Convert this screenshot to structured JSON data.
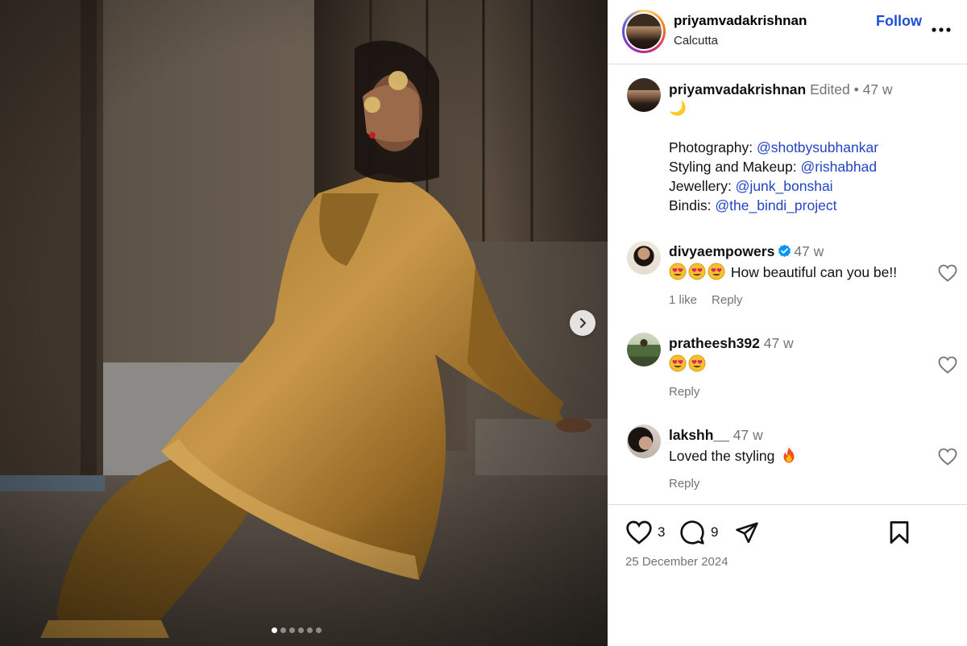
{
  "post": {
    "author": "priyamvadakrishnan",
    "location": "Calcutta",
    "follow_label": "Follow",
    "more_label": "•••",
    "image_alt": "Woman in golden brocade kurta sitting against a weathered wooden door, hand covering one eye",
    "carousel": {
      "total": 6,
      "active_index": 0
    }
  },
  "caption": {
    "username": "priyamvadakrishnan",
    "edited": "Edited",
    "separator": "•",
    "time": "47 w",
    "emoji_line": "🌙",
    "credits": [
      {
        "label": "Photography: ",
        "mention": "@shotbysubhankar"
      },
      {
        "label": "Styling and Makeup: ",
        "mention": "@rishabhad"
      },
      {
        "label": "Jewellery: ",
        "mention": "@junk_bonshai"
      },
      {
        "label": "Bindis: ",
        "mention": "@the_bindi_project"
      }
    ]
  },
  "comments": [
    {
      "username": "divyaempowers",
      "verified": true,
      "time": "47 w",
      "text": "How beautiful can you be!!",
      "emoji_count": 3,
      "likes": "1 like",
      "reply": "Reply"
    },
    {
      "username": "pratheesh392",
      "verified": false,
      "time": "47 w",
      "text": "",
      "emoji_count": 2,
      "likes": "",
      "reply": "Reply"
    },
    {
      "username": "lakshh__",
      "verified": false,
      "time": "47 w",
      "text": "Loved the styling",
      "trailing_emoji": "fire",
      "likes": "",
      "reply": "Reply"
    }
  ],
  "footer": {
    "like_count": "3",
    "comment_count": "9",
    "date": "25 December 2024"
  },
  "colors": {
    "accent_blue": "#1b4fd6",
    "mention_blue": "#2344c4",
    "muted_gray": "#737373",
    "divider": "#dbdbdb",
    "verified_blue": "#0095f6"
  }
}
